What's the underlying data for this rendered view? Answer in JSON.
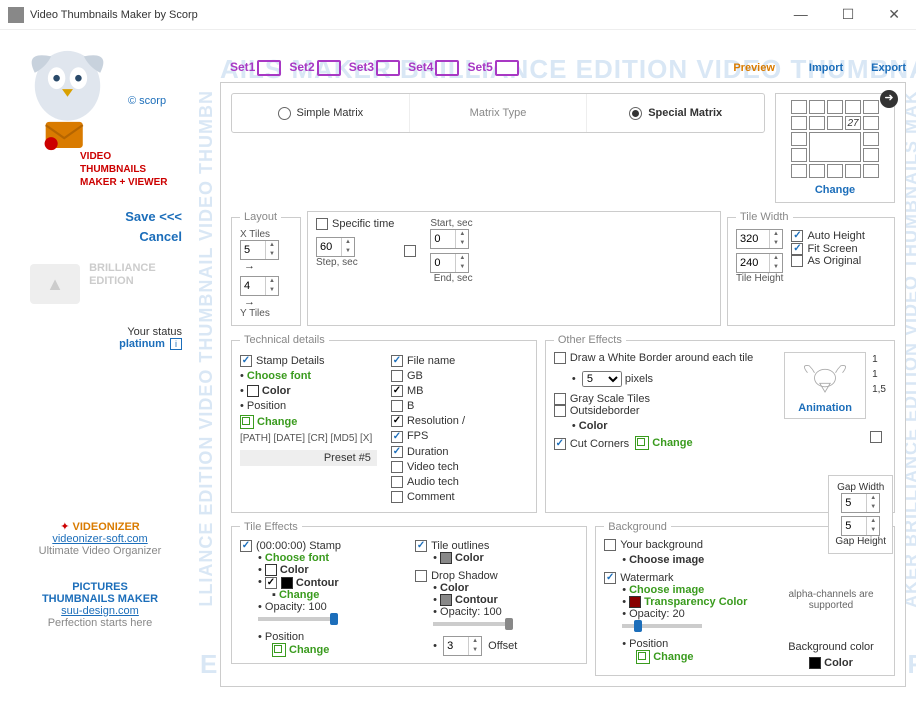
{
  "title": "Video Thumbnails Maker by Scorp",
  "sidebar": {
    "scorp": "© scorp",
    "red1": "VIDEO",
    "red2": "THUMBNAILS",
    "red3": "MAKER + VIEWER",
    "save": "Save <<<",
    "cancel": "Cancel",
    "edition1": "BRILLIANCE",
    "edition2": "EDITION",
    "status_lbl": "Your status",
    "status": "platinum",
    "promo1_name": "VIDEONIZER",
    "promo1_link": "videonizer-soft.com",
    "promo1_sub": "Ultimate Video Organizer",
    "promo2_l1": "PICTURES",
    "promo2_l2": "THUMBNAILS MAKER",
    "promo2_link": "suu-design.com",
    "promo2_sub": "Perfection starts here"
  },
  "tabs": {
    "s1": "Set1",
    "s2": "Set2",
    "s3": "Set3",
    "s4": "Set4",
    "s5": "Set5",
    "preview": "Preview",
    "import": "Import",
    "export": "Export"
  },
  "matrix": {
    "simple": "Simple Matrix",
    "type": "Matrix Type",
    "special": "Special Matrix",
    "count": "27",
    "change": "Change"
  },
  "layout": {
    "legend": "Layout",
    "xtiles": "X Tiles",
    "xval": "5",
    "ytiles": "Y Tiles",
    "yval": "4"
  },
  "timing": {
    "specific": "Specific time",
    "startsec": "Start, sec",
    "startval": "0",
    "stepval": "60",
    "stepsec": "Step, sec",
    "endval": "0",
    "endsec": "End, sec"
  },
  "tilew": {
    "legend": "Tile Width",
    "w": "320",
    "h": "240",
    "tileh": "Tile Height",
    "auto": "Auto Height",
    "fit": "Fit Screen",
    "asorig": "As Original"
  },
  "tech": {
    "legend": "Technical  details",
    "stamp": "Stamp Details",
    "choosefont": "Choose font",
    "color": "Color",
    "position": "Position",
    "change": "Change",
    "path": "[PATH] [DATE] [CR] [MD5] [X]",
    "preset": "Preset #5",
    "file": "File name",
    "gb": "GB",
    "mb": "MB",
    "b": "B",
    "res": "Resolution / ",
    "fps": "FPS",
    "dur": "Duration",
    "vtech": "Video tech",
    "atech": "Audio tech",
    "comment": "Comment"
  },
  "other": {
    "legend": "Other Effects",
    "whiteborder": "Draw a White Border around each tile",
    "pixels": "pixels",
    "pxval": "5",
    "gray": "Gray Scale Tiles",
    "outside": "Outsideborder",
    "color": "Color",
    "cut": "Cut Corners",
    "change": "Change",
    "anim": "Animation",
    "n1": "1",
    "n2": "1",
    "n3": "1,5"
  },
  "gap": {
    "width_lbl": "Gap Width",
    "wval": "5",
    "height_lbl": "Gap Height",
    "hval": "5"
  },
  "tilefx": {
    "legend": "Tile Effects",
    "tstamp": "(00:00:00) Stamp",
    "choosefont": "Choose font",
    "color": "Color",
    "contour": "Contour",
    "change": "Change",
    "opacity": "Opacity: ",
    "opval": "100",
    "position": "Position",
    "outlines": "Tile outlines",
    "drop": "Drop Shadow",
    "offset": "Offset",
    "offval": "3",
    "op2": "100"
  },
  "bg": {
    "legend": "Background",
    "your": "Your background",
    "chooseimg": "Choose image",
    "water": "Watermark",
    "trans": "Transparency Color",
    "opacity": "Opacity: ",
    "opval": "20",
    "position": "Position",
    "change": "Change",
    "alpha": "alpha-channels are supported",
    "bgcolor": "Background color",
    "color": "Color"
  }
}
